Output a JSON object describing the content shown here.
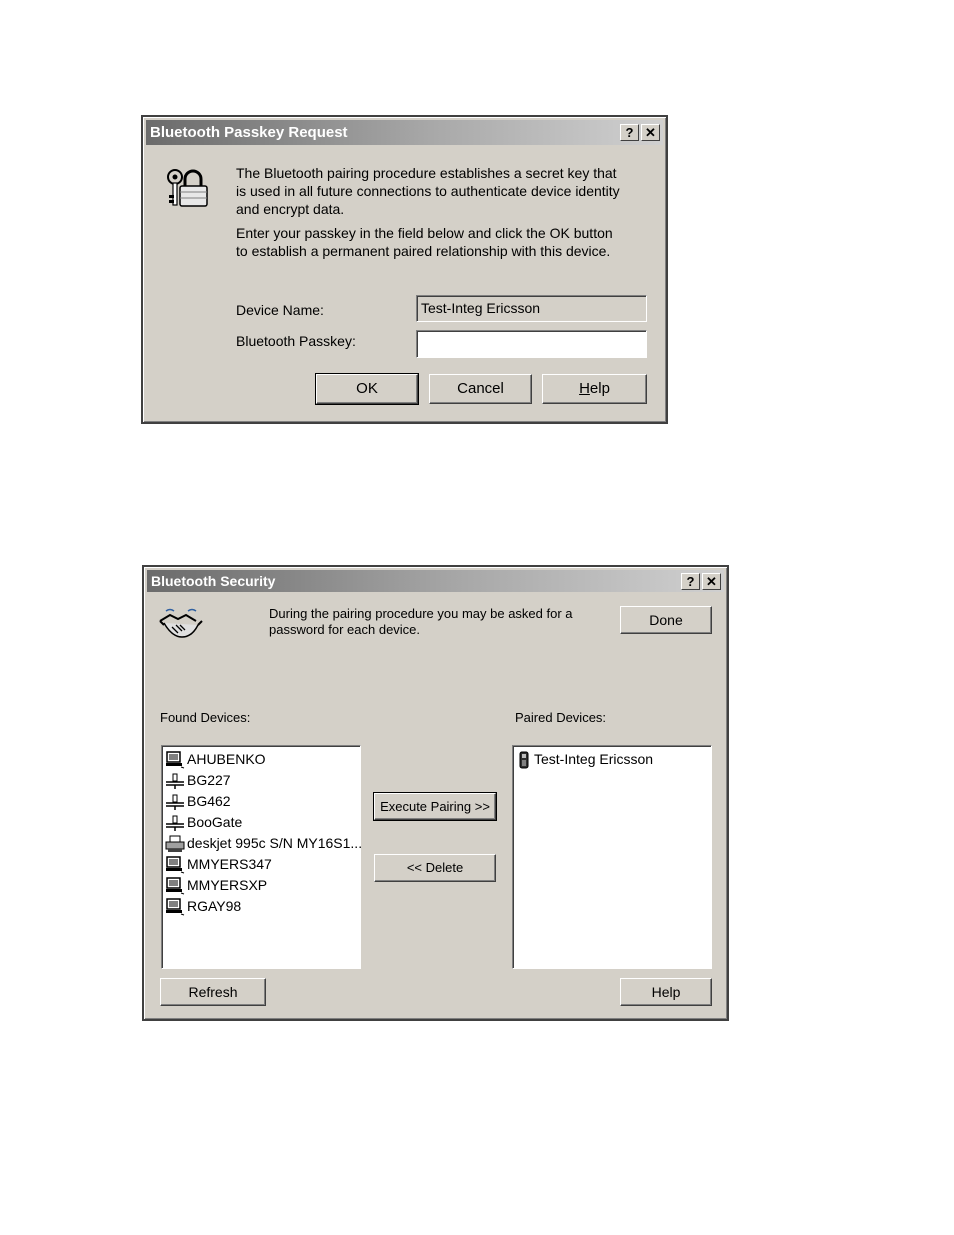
{
  "passkey_dialog": {
    "title": "Bluetooth Passkey Request",
    "help_btn": "?",
    "close_btn": "✕",
    "paragraph1_lines": [
      "The Bluetooth pairing procedure establishes a secret key that",
      "is used in all future connections to authenticate device identity",
      "and encrypt data."
    ],
    "paragraph2_lines": [
      "Enter your passkey in the field below and click the OK button",
      "to establish a permanent paired relationship with this device."
    ],
    "device_name_label": "Device Name:",
    "device_name_value": "Test-Integ Ericsson",
    "passkey_label": "Bluetooth Passkey:",
    "passkey_value": "",
    "ok_label": "OK",
    "cancel_label": "Cancel",
    "help_label_prefix": "",
    "help_label_u": "H",
    "help_label_rest": "elp"
  },
  "security_dialog": {
    "title": "Bluetooth Security",
    "help_btn": "?",
    "close_btn": "✕",
    "intro_lines": [
      "During the pairing procedure you may be asked for a",
      "password for each device."
    ],
    "done_label": "Done",
    "found_label": "Found Devices:",
    "paired_label": "Paired Devices:",
    "found_devices": [
      {
        "name": "AHUBENKO",
        "icon": "computer-icon"
      },
      {
        "name": "BG227",
        "icon": "network-icon"
      },
      {
        "name": "BG462",
        "icon": "network-icon"
      },
      {
        "name": "BooGate",
        "icon": "network-icon"
      },
      {
        "name": "deskjet 995c S/N MY16S1...",
        "icon": "printer-icon"
      },
      {
        "name": "MMYERS347",
        "icon": "computer-icon"
      },
      {
        "name": "MMYERSXP",
        "icon": "computer-icon"
      },
      {
        "name": "RGAY98",
        "icon": "computer-icon"
      }
    ],
    "paired_devices": [
      {
        "name": "Test-Integ Ericsson",
        "icon": "phone-icon"
      }
    ],
    "execute_label": "Execute Pairing >>",
    "delete_label": "<< Delete",
    "refresh_label": "Refresh",
    "help_label": "Help"
  }
}
